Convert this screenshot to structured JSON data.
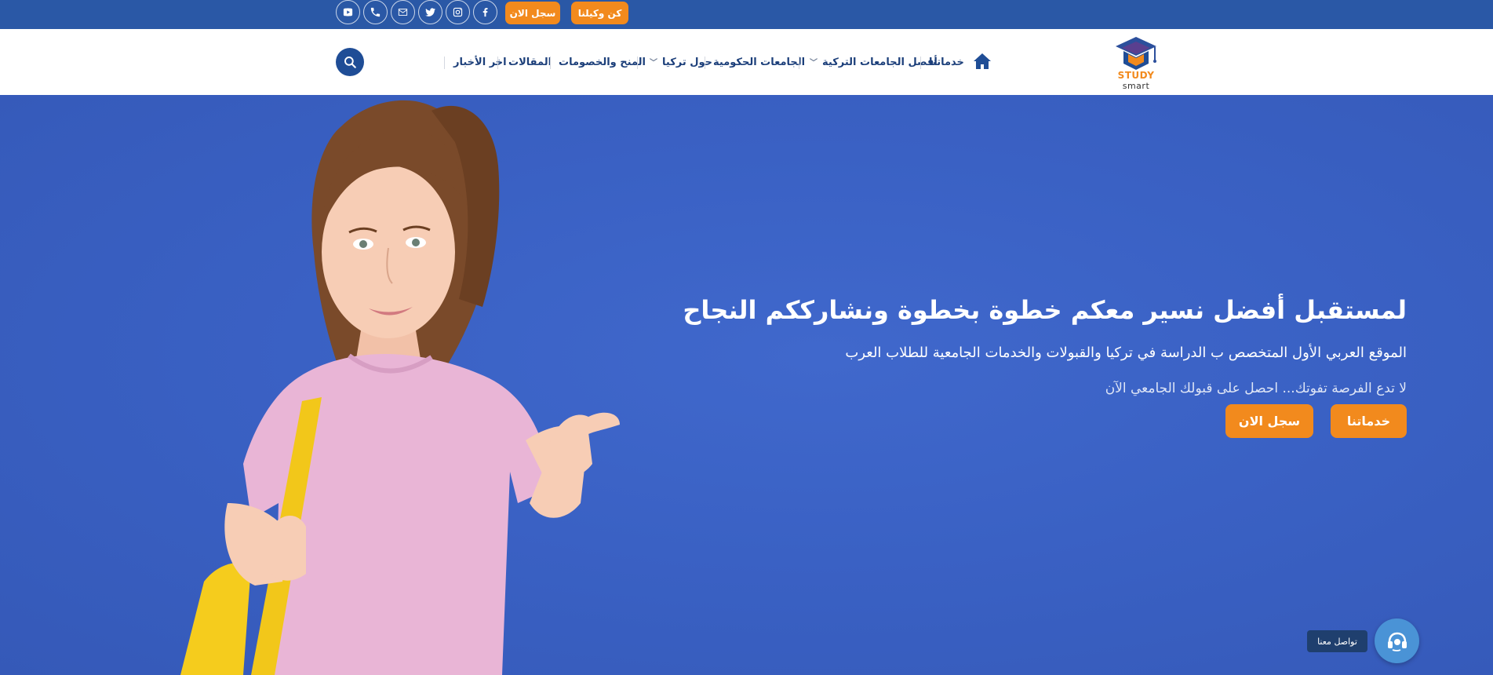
{
  "topbar": {
    "register_label": "سجل الان",
    "agent_label": "كن وكيلنا",
    "social_icons": [
      "youtube-icon",
      "phone-icon",
      "email-icon",
      "twitter-icon",
      "instagram-icon",
      "facebook-icon"
    ]
  },
  "header": {
    "logo": {
      "word1": "STUDY",
      "word2": "smart"
    },
    "nav": {
      "services": "خدماتنا",
      "best_universities": "أفضل الجامعات التركية",
      "public_universities": "الجامعات الحكومية",
      "about_turkey": "حول تركيا",
      "scholarships": "المنح والخصومات",
      "articles": "المقالات",
      "news": "اخر الأخبار"
    }
  },
  "hero": {
    "title": "لمستقبل أفضل نسير معكم خطوة بخطوة ونشارككم النجاح",
    "subtitle": "الموقع العربي الأول المتخصص ب الدراسة في تركيا والقبولات والخدمات الجامعية للطلاب العرب",
    "note": "لا تدع الفرصة تفوتك... احصل على قبولك الجامعي الآن",
    "services_button": "خدماتنا",
    "register_button": "سجل الان"
  },
  "contact": {
    "label": "تواصل معنا"
  },
  "colors": {
    "primary": "#2a58a6",
    "accent": "#f28a1d",
    "hero_bg": "#3a61c4",
    "nav_text": "#1c3f7a"
  }
}
